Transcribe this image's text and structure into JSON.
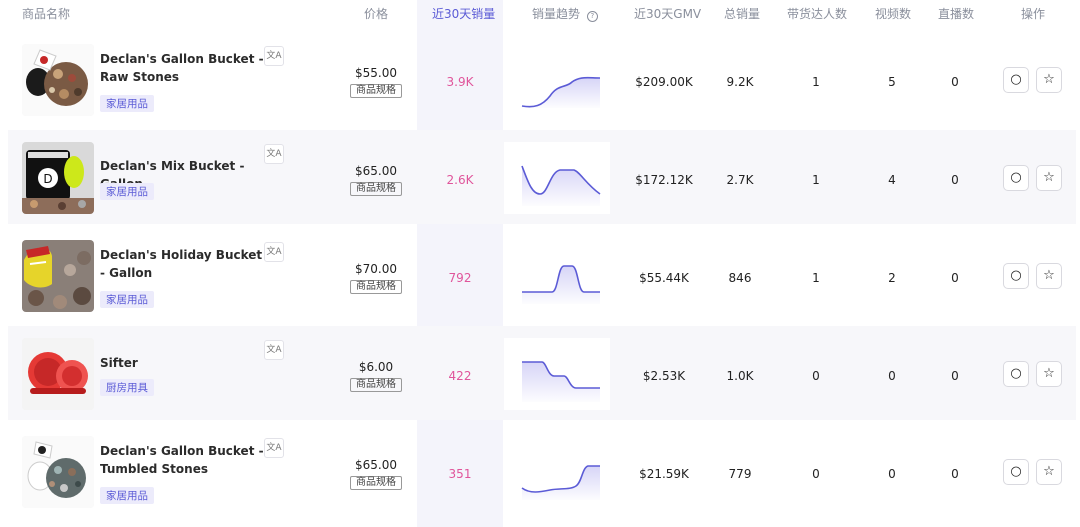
{
  "header": {
    "name": "商品名称",
    "price": "价格",
    "sales30": "近30天销量",
    "trend": "销量趋势",
    "gmv30": "近30天GMV",
    "total_sales": "总销量",
    "creators": "带货达人数",
    "videos": "视频数",
    "lives": "直播数",
    "actions": "操作",
    "sorted_color": "#5b5bd6"
  },
  "spec_label": "商品规格",
  "rows": [
    {
      "name": "Declan's Gallon Bucket - Raw Stones",
      "tag": "家居用品",
      "price": "$55.00",
      "sales30": "3.9K",
      "gmv": "$209.00K",
      "total": "9.2K",
      "creators": "1",
      "videos": "5",
      "lives": "0",
      "trend": "rise"
    },
    {
      "name": "Declan's Mix Bucket - Gallon",
      "tag": "家居用品",
      "price": "$65.00",
      "sales30": "2.6K",
      "gmv": "$172.12K",
      "total": "2.7K",
      "creators": "1",
      "videos": "4",
      "lives": "0",
      "trend": "dip-plateau"
    },
    {
      "name": "Declan's Holiday Bucket - Gallon",
      "tag": "家居用品",
      "price": "$70.00",
      "sales30": "792",
      "gmv": "$55.44K",
      "total": "846",
      "creators": "1",
      "videos": "2",
      "lives": "0",
      "trend": "spike"
    },
    {
      "name": "Sifter",
      "tag": "厨房用具",
      "price": "$6.00",
      "sales30": "422",
      "gmv": "$2.53K",
      "total": "1.0K",
      "creators": "0",
      "videos": "0",
      "lives": "0",
      "trend": "decline"
    },
    {
      "name": "Declan's Gallon Bucket - Tumbled Stones",
      "tag": "家居用品",
      "price": "$65.00",
      "sales30": "351",
      "gmv": "$21.59K",
      "total": "779",
      "creators": "0",
      "videos": "0",
      "lives": "0",
      "trend": "late-rise"
    }
  ],
  "icons": {
    "translate": "translate-icon",
    "circle": "circle-action-icon",
    "star": "star-icon"
  }
}
